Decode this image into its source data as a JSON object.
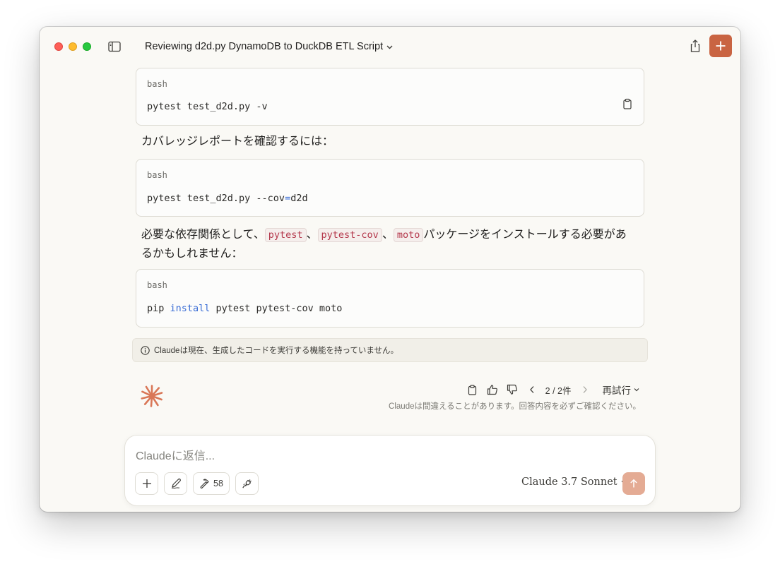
{
  "window": {
    "title": "Reviewing d2d.py DynamoDB to DuckDB ETL Script"
  },
  "blocks": {
    "code1": {
      "lang": "bash",
      "line": "pytest test_d2d.py -v"
    },
    "para1": "カバレッジレポートを確認するには：",
    "code2": {
      "lang": "bash",
      "pre": "pytest test_d2d.py --cov",
      "op": "=",
      "post": "d2d"
    },
    "para2": {
      "t1": "必要な依存関係として、",
      "c1": "pytest",
      "sep": "、",
      "c2": "pytest-cov",
      "c3": "moto",
      "t2": "パッケージをインストールする必要があ",
      "t3": "るかもしれません："
    },
    "code3": {
      "lang": "bash",
      "pre": "pip ",
      "kw": "install",
      "post": " pytest pytest-cov moto"
    }
  },
  "notice": "Claudeは現在、生成したコードを実行する機能を持っていません。",
  "message_actions": {
    "page": "2 / 2件",
    "retry": "再試行"
  },
  "disclaimer": "Claudeは間違えることがあります。回答内容を必ずご確認ください。",
  "composer": {
    "placeholder": "Claudeに返信...",
    "tools_count": "58",
    "model": "Claude 3.7 Sonnet"
  },
  "colors": {
    "accent": "#c96442",
    "send_disabled": "#e4ab94",
    "background": "#faf9f5",
    "inline_code": "#b4374b",
    "keyword": "#3d6fd6"
  },
  "icons": [
    "sidebar-toggle-icon",
    "chevron-down-icon",
    "share-icon",
    "plus-icon",
    "clipboard-icon",
    "info-icon",
    "claude-logo-icon",
    "thumbs-up-icon",
    "thumbs-down-icon",
    "chevron-left-icon",
    "chevron-right-icon",
    "pen-icon",
    "hammer-icon",
    "plug-icon",
    "arrow-up-icon"
  ]
}
